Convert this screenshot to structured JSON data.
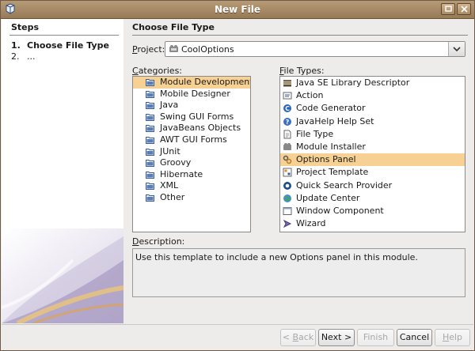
{
  "window": {
    "title": "New File"
  },
  "steps": {
    "heading": "Steps",
    "items": [
      {
        "num": "1.",
        "label": "Choose File Type"
      },
      {
        "num": "2.",
        "label": "..."
      }
    ]
  },
  "main": {
    "heading": "Choose File Type",
    "project_label_prefix": "",
    "project_label_mnemonic": "P",
    "project_label_rest": "roject:",
    "project_value": "CoolOptions",
    "categories_label_mnemonic": "C",
    "categories_label_rest": "ategories:",
    "categories": [
      {
        "label": "Module Development",
        "selected": true
      },
      {
        "label": "Mobile Designer"
      },
      {
        "label": "Java"
      },
      {
        "label": "Swing GUI Forms"
      },
      {
        "label": "JavaBeans Objects"
      },
      {
        "label": "AWT GUI Forms"
      },
      {
        "label": "JUnit"
      },
      {
        "label": "Groovy"
      },
      {
        "label": "Hibernate"
      },
      {
        "label": "XML"
      },
      {
        "label": "Other"
      }
    ],
    "file_types_label_mnemonic": "F",
    "file_types_label_rest": "ile Types:",
    "file_types": [
      {
        "label": "Java SE Library Descriptor",
        "icon": "library-icon"
      },
      {
        "label": "Action",
        "icon": "action-icon"
      },
      {
        "label": "Code Generator",
        "icon": "code-generator-icon"
      },
      {
        "label": "JavaHelp Help Set",
        "icon": "help-icon"
      },
      {
        "label": "File Type",
        "icon": "file-icon"
      },
      {
        "label": "Module Installer",
        "icon": "puzzle-icon"
      },
      {
        "label": "Options Panel",
        "icon": "options-icon",
        "selected": true
      },
      {
        "label": "Project Template",
        "icon": "template-icon"
      },
      {
        "label": "Quick Search Provider",
        "icon": "search-icon"
      },
      {
        "label": "Update Center",
        "icon": "globe-icon"
      },
      {
        "label": "Window Component",
        "icon": "window-icon"
      },
      {
        "label": "Wizard",
        "icon": "wizard-icon"
      }
    ],
    "description_label_mnemonic": "D",
    "description_label_rest": "escription:",
    "description": "Use this template to include a new Options panel in this module."
  },
  "buttons": {
    "back": {
      "prefix": "< ",
      "mnemonic": "B",
      "rest": "ack"
    },
    "next": {
      "label": "Next >"
    },
    "finish": {
      "label": "Finish"
    },
    "cancel": {
      "label": "Cancel"
    },
    "help": {
      "mnemonic": "H",
      "rest": "elp"
    }
  },
  "colors": {
    "selection": "#f7d193",
    "titlebar": "#a88a63",
    "folder": "#4a6ea8"
  }
}
